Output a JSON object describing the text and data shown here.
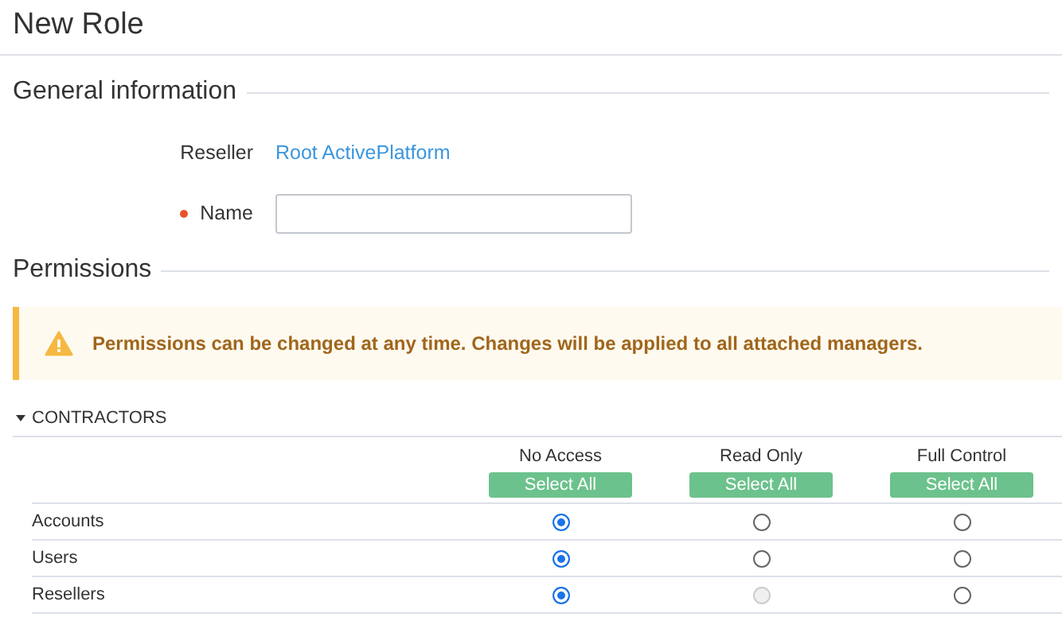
{
  "page_title": "New Role",
  "general_information": {
    "heading": "General information",
    "reseller": {
      "label": "Reseller",
      "value": "Root ActivePlatform"
    },
    "name": {
      "label": "Name",
      "required": true
    }
  },
  "permissions": {
    "heading": "Permissions",
    "alert": "Permissions can be changed at any time. Changes will be applied to all attached managers.",
    "sections": [
      {
        "title": "CONTRACTORS",
        "expanded": true,
        "columns": [
          {
            "label": "No Access",
            "button": "Select All"
          },
          {
            "label": "Read Only",
            "button": "Select All"
          },
          {
            "label": "Full Control",
            "button": "Select All"
          }
        ],
        "rows": [
          {
            "label": "Accounts",
            "options": [
              {
                "selected": true,
                "disabled": false
              },
              {
                "selected": false,
                "disabled": false
              },
              {
                "selected": false,
                "disabled": false
              }
            ]
          },
          {
            "label": "Users",
            "options": [
              {
                "selected": true,
                "disabled": false
              },
              {
                "selected": false,
                "disabled": false
              },
              {
                "selected": false,
                "disabled": false
              }
            ]
          },
          {
            "label": "Resellers",
            "options": [
              {
                "selected": true,
                "disabled": false
              },
              {
                "selected": false,
                "disabled": true
              },
              {
                "selected": false,
                "disabled": false
              }
            ]
          }
        ]
      }
    ]
  }
}
